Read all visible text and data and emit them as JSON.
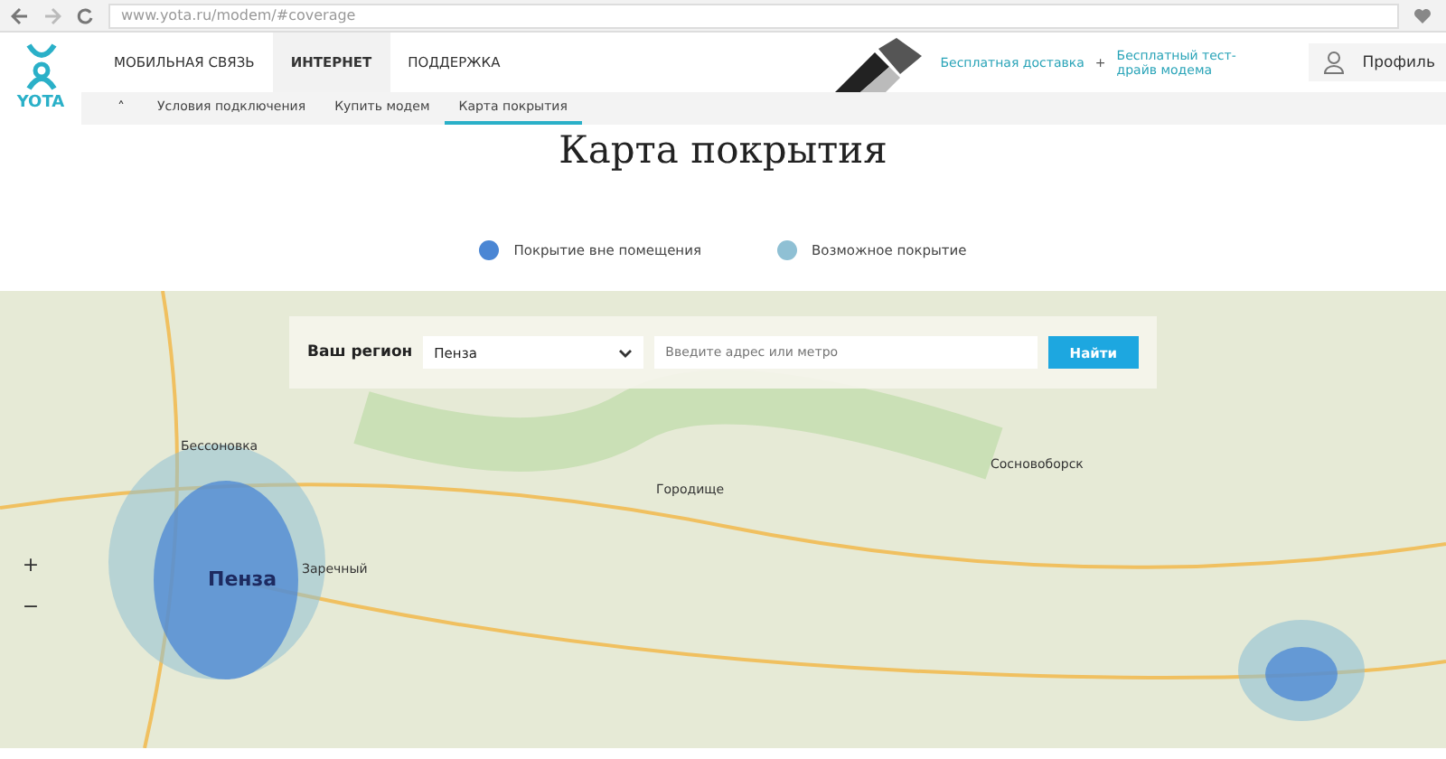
{
  "browser": {
    "url": "www.yota.ru/modem/#coverage"
  },
  "header": {
    "logo": "YOTA",
    "nav": [
      {
        "label": "МОБИЛЬНАЯ СВЯЗЬ",
        "selected": false
      },
      {
        "label": "ИНТЕРНЕТ",
        "selected": true
      },
      {
        "label": "ПОДДЕРЖКА",
        "selected": false
      }
    ],
    "promo": [
      "Бесплатная доставка",
      "+",
      "Бесплатный тест-драйв модема"
    ],
    "profile": "Профиль"
  },
  "subnav": {
    "toggle": "˄",
    "items": [
      {
        "label": "Условия подключения",
        "selected": false
      },
      {
        "label": "Купить модем",
        "selected": false
      },
      {
        "label": "Карта покрытия",
        "selected": true
      }
    ]
  },
  "title": "Карта покрытия",
  "legend": [
    {
      "label": "Покрытие вне помещения",
      "color": "#4a86d4"
    },
    {
      "label": "Возможное покрытие",
      "color": "#8fc0d4"
    }
  ],
  "map": {
    "region_label": "Ваш регион",
    "region_value": "Пенза",
    "address_placeholder": "Введите адрес или метро",
    "search_button": "Найти",
    "zoom": [
      "+",
      "−"
    ],
    "places": [
      "Бессоновка",
      "Пенза",
      "Заречный",
      "Городище",
      "Сосновоборск"
    ]
  }
}
